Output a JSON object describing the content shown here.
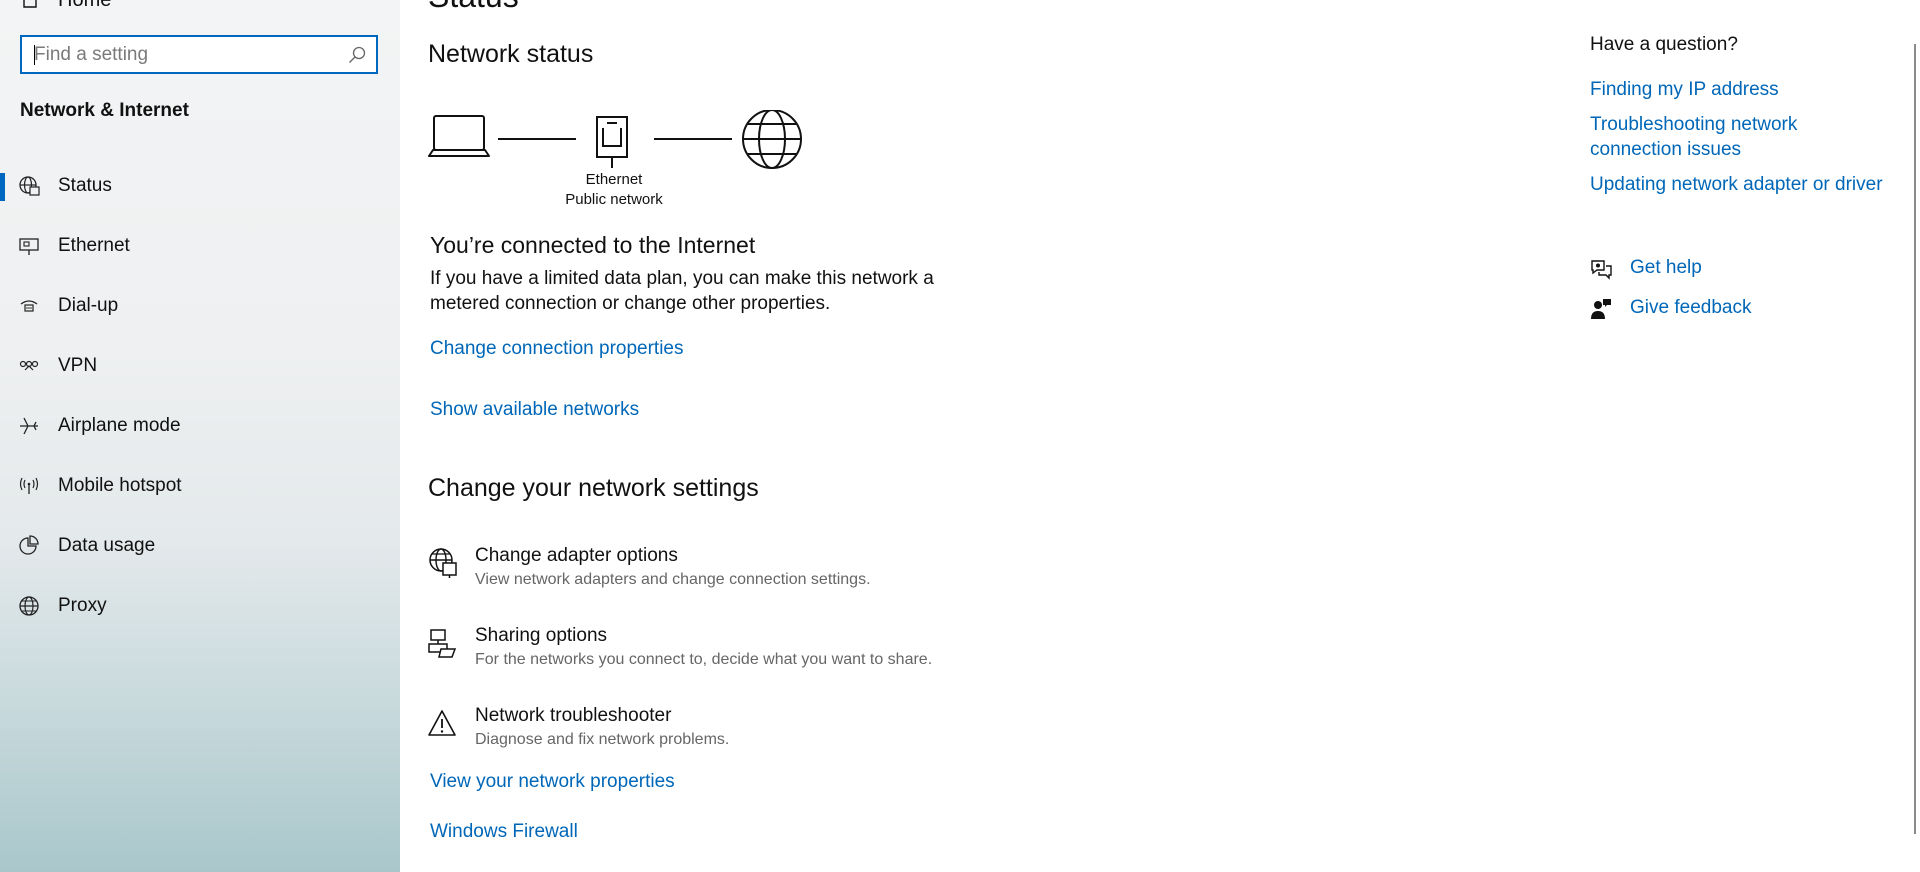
{
  "sidebar": {
    "home_label": "Home",
    "search": {
      "placeholder": "Find a setting",
      "value": ""
    },
    "section_title": "Network & Internet",
    "items": [
      {
        "label": "Status",
        "icon": "status-globe-icon",
        "selected": true
      },
      {
        "label": "Ethernet",
        "icon": "ethernet-icon",
        "selected": false
      },
      {
        "label": "Dial-up",
        "icon": "dialup-icon",
        "selected": false
      },
      {
        "label": "VPN",
        "icon": "vpn-icon",
        "selected": false
      },
      {
        "label": "Airplane mode",
        "icon": "airplane-icon",
        "selected": false
      },
      {
        "label": "Mobile hotspot",
        "icon": "hotspot-icon",
        "selected": false
      },
      {
        "label": "Data usage",
        "icon": "data-usage-icon",
        "selected": false
      },
      {
        "label": "Proxy",
        "icon": "proxy-globe-icon",
        "selected": false
      }
    ]
  },
  "main": {
    "page_title": "Status",
    "network_status_heading": "Network status",
    "diagram": {
      "adapter_name": "Ethernet",
      "network_type": "Public network"
    },
    "connected_title": "You’re connected to the Internet",
    "connected_desc": "If you have a limited data plan, you can make this network a metered connection or change other properties.",
    "change_connection_link": "Change connection properties",
    "show_networks_link": "Show available networks",
    "change_settings_heading": "Change your network settings",
    "options": [
      {
        "title": "Change adapter options",
        "desc": "View network adapters and change connection settings.",
        "icon": "adapter-globe-icon"
      },
      {
        "title": "Sharing options",
        "desc": "For the networks you connect to, decide what you want to share.",
        "icon": "sharing-icon"
      },
      {
        "title": "Network troubleshooter",
        "desc": "Diagnose and fix network problems.",
        "icon": "warning-icon"
      }
    ],
    "view_properties_link": "View your network properties",
    "firewall_link": "Windows Firewall"
  },
  "help": {
    "title": "Have a question?",
    "links": [
      "Finding my IP address",
      "Troubleshooting network connection issues",
      "Updating network adapter or driver"
    ],
    "get_help": "Get help",
    "give_feedback": "Give feedback"
  },
  "colors": {
    "accent": "#0067c0",
    "link": "#0067b8"
  }
}
